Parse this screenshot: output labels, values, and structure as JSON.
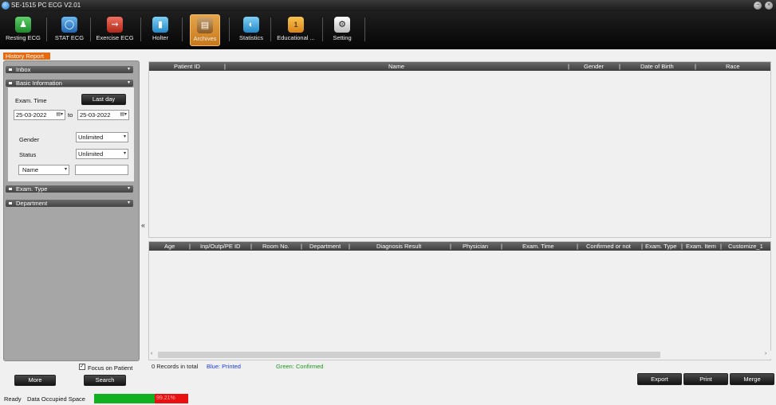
{
  "window": {
    "title": "SE-1515 PC ECG V2.01"
  },
  "toolbar": {
    "items": [
      {
        "label": "Resting ECG",
        "icon": "person-icon"
      },
      {
        "label": "STAT ECG",
        "icon": "globe-icon"
      },
      {
        "label": "Exercise ECG",
        "icon": "runner-icon"
      },
      {
        "label": "Holter",
        "icon": "holter-icon"
      },
      {
        "label": "Archives",
        "icon": "archive-icon"
      },
      {
        "label": "Statistics",
        "icon": "statistics-icon"
      },
      {
        "label": "Educational ...",
        "icon": "education-icon"
      },
      {
        "label": "Setting",
        "icon": "gear-icon"
      }
    ],
    "active": "Archives"
  },
  "history_tab": "History Report",
  "left": {
    "inbox": "Inbox",
    "basic": "Basic Information",
    "exam_time_label": "Exam. Time",
    "last_day": "Last day",
    "date_from": "25-03-2022",
    "to": "to",
    "date_to": "25-03-2022",
    "gender_label": "Gender",
    "gender_value": "Unlimited",
    "status_label": "Status",
    "status_value": "Unlimited",
    "name_select": "Name",
    "name_value": "",
    "exam_type": "Exam. Type",
    "department": "Department"
  },
  "table_top": {
    "columns": [
      "Patient ID",
      "Name",
      "Gender",
      "Date of Birth",
      "Race"
    ]
  },
  "table_bottom": {
    "columns": [
      "Age",
      "Inp/Outp/PE ID",
      "Room No.",
      "Department",
      "Diagnosis Result",
      "Physician",
      "Exam. Time",
      "Confirmed or not",
      "Exam. Type",
      "Exam. Item",
      "Customize_1"
    ]
  },
  "focus_on_patient": "Focus on Patient",
  "buttons": {
    "more": "More",
    "search": "Search",
    "export": "Export",
    "print": "Print",
    "merge": "Merge"
  },
  "status": {
    "records": "0 Records in total",
    "printed": "Blue: Printed",
    "confirmed": "Green: Confirmed",
    "ready": "Ready",
    "data_space": "Data Occupied Space",
    "occupied_pct": "99.21%"
  },
  "colors": {
    "accent": "#e86a10",
    "printed": "#1a3ae0",
    "confirmed": "#1a9a1a"
  }
}
